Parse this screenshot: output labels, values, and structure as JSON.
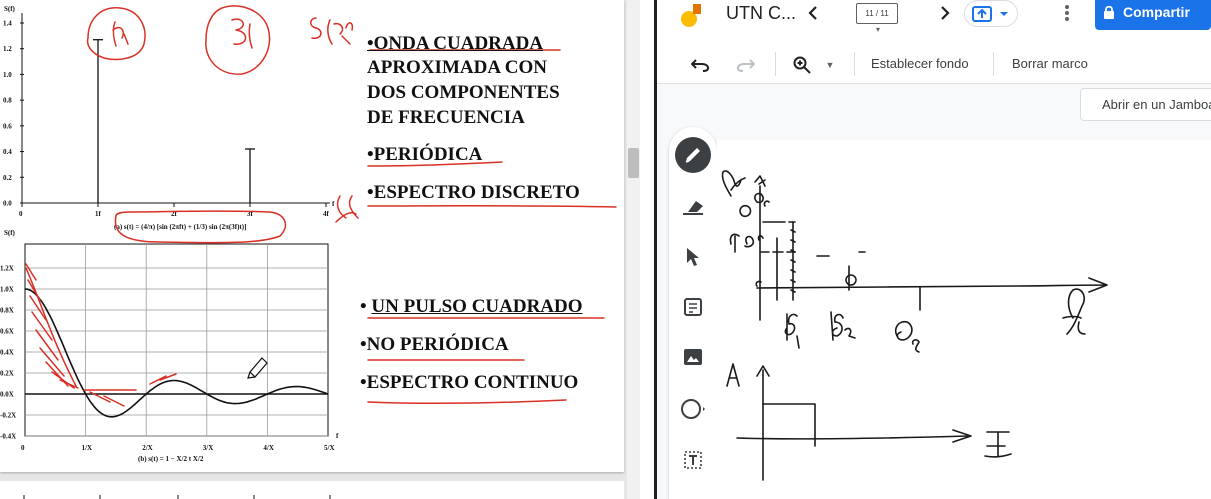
{
  "slide": {
    "upper_chart": {
      "y_axis_label": "S(f)",
      "y_ticks": [
        "1.4",
        "1.2",
        "1.0",
        "0.8",
        "0.6",
        "0.4",
        "0.2",
        "0.0"
      ],
      "x_ticks": [
        "0",
        "1f",
        "2f",
        "3f",
        "4f"
      ],
      "x_axis_label": "f",
      "caption": "(a) s(t) = (4/π) [sin (2πft) + (1/3) sin (2π(3f)t)]"
    },
    "lower_chart": {
      "y_axis_label": "S(f)",
      "y_ticks": [
        "1.2X",
        "1.0X",
        "0.8X",
        "0.6X",
        "0.4X",
        "0.2X",
        "0.0X",
        "-0.2X",
        "-0.4X"
      ],
      "x_ticks": [
        "0",
        "1/X",
        "2/X",
        "3/X",
        "4/X",
        "5/X"
      ],
      "x_axis_label": "f",
      "caption": "(b) s(t) = 1     − X/2    t    X/2"
    },
    "text_upper": {
      "line1": "•ONDA CUADRADA",
      "line2": "APROXIMADA CON",
      "line3": "DOS COMPONENTES",
      "line4": "DE FRECUENCIA",
      "line5": "•PERIÓDICA",
      "line6": "•ESPECTRO DISCRETO"
    },
    "text_lower": {
      "line1a": "• ",
      "line1b": "UN PULSO CUADRADO",
      "line2": "•NO PERIÓDICA",
      "line3": "•ESPECTRO CONTINUO"
    },
    "chart_data": [
      {
        "type": "bar",
        "title": "",
        "ylabel": "S(f)",
        "xlabel": "f",
        "categories": [
          "0",
          "1f",
          "2f",
          "3f",
          "4f"
        ],
        "values": [
          0,
          1.27,
          0,
          0.42,
          0
        ],
        "ylim": [
          0,
          1.4
        ]
      },
      {
        "type": "line",
        "title": "",
        "ylabel": "S(f)",
        "xlabel": "f",
        "x": [
          0,
          0.5,
          1,
          1.5,
          2,
          2.5,
          3,
          3.5,
          4,
          4.5,
          5
        ],
        "y": [
          1.0,
          0.64,
          0.0,
          -0.21,
          0.0,
          0.13,
          0.0,
          -0.09,
          0.0,
          0.07,
          0.0
        ],
        "xlim": [
          0,
          5
        ],
        "ylim": [
          -0.4,
          1.2
        ],
        "grid": true
      }
    ]
  },
  "jamboard": {
    "title": "UTN C...",
    "frame_counter": "11 / 11",
    "share_label": "Compartir",
    "set_background_label": "Establecer fondo",
    "clear_frame_label": "Borrar marco",
    "open_in_jamboard_label": "Abrir en un Jamboard"
  }
}
